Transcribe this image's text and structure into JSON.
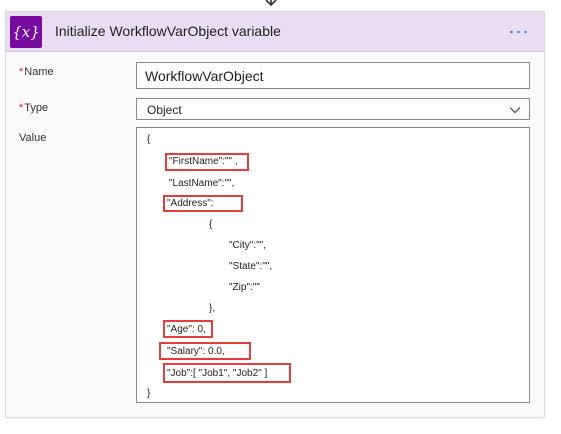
{
  "card": {
    "title": "Initialize WorkflowVarObject variable",
    "icon_glyph": "{x}",
    "icon_name": "variable-icon",
    "more_glyph": "···",
    "accent_color": "#770ba0",
    "header_bg": "#eadcf2"
  },
  "fields": {
    "name_label": "Name",
    "name_value": "WorkflowVarObject",
    "type_label": "Type",
    "type_value": "Object",
    "value_label": "Value",
    "required_mark": "*"
  },
  "value_lines": [
    "{",
    "\"FirstName\":\"\" ,",
    "\"LastName\":\"\",",
    "\"Address\":",
    "{",
    "\"City\":\"\",",
    "\"State\":\"\",",
    "\"Zip\":\"\"",
    "},",
    "\"Age\": 0,",
    "\"Salary\": 0.0,",
    "\"Job\":[ \"Job1\", \"Job2\" ]",
    "}"
  ],
  "highlight_color": "#e53c3c"
}
